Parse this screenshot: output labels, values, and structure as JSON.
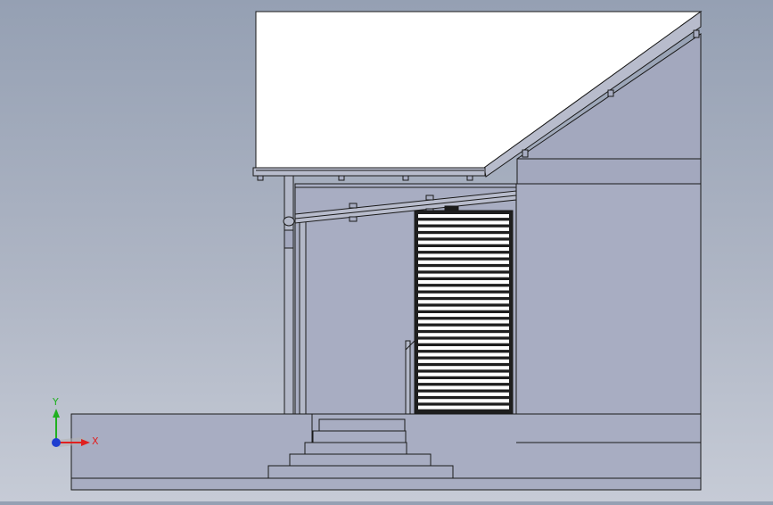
{
  "viewport": {
    "background_top": "#95a0b3",
    "background_bottom": "#c6cbd6"
  },
  "model": {
    "roof_color": "#ffffff",
    "wall_color": "#a8adc2",
    "edge_color": "#1a1a1a",
    "shutter_slat_color": "#ffffff",
    "shutter_slat_count": 30
  },
  "triad": {
    "x_label": "X",
    "y_label": "Y",
    "x_color": "#e02020",
    "y_color": "#20b020",
    "z_color": "#1f3fd0"
  }
}
